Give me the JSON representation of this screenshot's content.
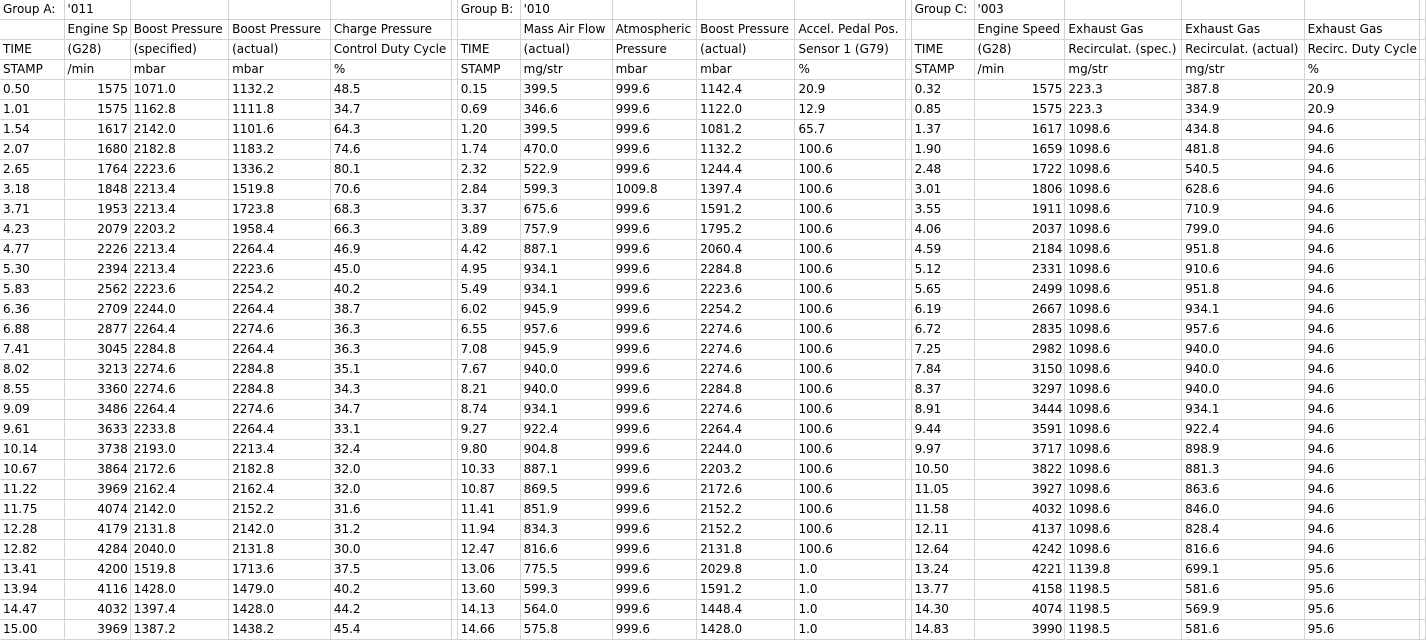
{
  "header_rows": [
    [
      "Group A:",
      "'011",
      "",
      "",
      "",
      "",
      "Group B:",
      "'010",
      "",
      "",
      "",
      "",
      "Group C:",
      "'003",
      "",
      "",
      "",
      ""
    ],
    [
      "",
      "Engine Sp",
      "Boost Pressure",
      "Boost Pressure",
      "Charge Pressure",
      "",
      "",
      "Mass Air Flow",
      "Atmospheric",
      "Boost Pressure",
      "Accel. Pedal Pos.",
      "",
      "",
      "Engine Speed",
      "Exhaust Gas",
      "Exhaust Gas",
      "Exhaust Gas",
      ""
    ],
    [
      "TIME",
      "(G28)",
      "(specified)",
      "(actual)",
      "Control Duty Cycle",
      "",
      "TIME",
      "(actual)",
      "Pressure",
      "(actual)",
      "Sensor 1 (G79)",
      "",
      "TIME",
      "(G28)",
      "Recirculat. (spec.)",
      "Recirculat. (actual)",
      "Recirc. Duty Cycle",
      ""
    ],
    [
      "STAMP",
      "/min",
      "mbar",
      "mbar",
      "%",
      "",
      "STAMP",
      "mg/str",
      "mbar",
      "mbar",
      "%",
      "",
      "STAMP",
      "/min",
      "mg/str",
      "mg/str",
      "%",
      ""
    ]
  ],
  "data_rows": [
    [
      "0.50",
      "1575",
      "1071.0",
      "1132.2",
      "48.5",
      "",
      "0.15",
      "399.5",
      "999.6",
      "1142.4",
      "20.9",
      "",
      "0.32",
      "1575",
      "223.3",
      "387.8",
      "20.9",
      ""
    ],
    [
      "1.01",
      "1575",
      "1162.8",
      "1111.8",
      "34.7",
      "",
      "0.69",
      "346.6",
      "999.6",
      "1122.0",
      "12.9",
      "",
      "0.85",
      "1575",
      "223.3",
      "334.9",
      "20.9",
      ""
    ],
    [
      "1.54",
      "1617",
      "2142.0",
      "1101.6",
      "64.3",
      "",
      "1.20",
      "399.5",
      "999.6",
      "1081.2",
      "65.7",
      "",
      "1.37",
      "1617",
      "1098.6",
      "434.8",
      "94.6",
      ""
    ],
    [
      "2.07",
      "1680",
      "2182.8",
      "1183.2",
      "74.6",
      "",
      "1.74",
      "470.0",
      "999.6",
      "1132.2",
      "100.6",
      "",
      "1.90",
      "1659",
      "1098.6",
      "481.8",
      "94.6",
      ""
    ],
    [
      "2.65",
      "1764",
      "2223.6",
      "1336.2",
      "80.1",
      "",
      "2.32",
      "522.9",
      "999.6",
      "1244.4",
      "100.6",
      "",
      "2.48",
      "1722",
      "1098.6",
      "540.5",
      "94.6",
      ""
    ],
    [
      "3.18",
      "1848",
      "2213.4",
      "1519.8",
      "70.6",
      "",
      "2.84",
      "599.3",
      "1009.8",
      "1397.4",
      "100.6",
      "",
      "3.01",
      "1806",
      "1098.6",
      "628.6",
      "94.6",
      ""
    ],
    [
      "3.71",
      "1953",
      "2213.4",
      "1723.8",
      "68.3",
      "",
      "3.37",
      "675.6",
      "999.6",
      "1591.2",
      "100.6",
      "",
      "3.55",
      "1911",
      "1098.6",
      "710.9",
      "94.6",
      ""
    ],
    [
      "4.23",
      "2079",
      "2203.2",
      "1958.4",
      "66.3",
      "",
      "3.89",
      "757.9",
      "999.6",
      "1795.2",
      "100.6",
      "",
      "4.06",
      "2037",
      "1098.6",
      "799.0",
      "94.6",
      ""
    ],
    [
      "4.77",
      "2226",
      "2213.4",
      "2264.4",
      "46.9",
      "",
      "4.42",
      "887.1",
      "999.6",
      "2060.4",
      "100.6",
      "",
      "4.59",
      "2184",
      "1098.6",
      "951.8",
      "94.6",
      ""
    ],
    [
      "5.30",
      "2394",
      "2213.4",
      "2223.6",
      "45.0",
      "",
      "4.95",
      "934.1",
      "999.6",
      "2284.8",
      "100.6",
      "",
      "5.12",
      "2331",
      "1098.6",
      "910.6",
      "94.6",
      ""
    ],
    [
      "5.83",
      "2562",
      "2223.6",
      "2254.2",
      "40.2",
      "",
      "5.49",
      "934.1",
      "999.6",
      "2223.6",
      "100.6",
      "",
      "5.65",
      "2499",
      "1098.6",
      "951.8",
      "94.6",
      ""
    ],
    [
      "6.36",
      "2709",
      "2244.0",
      "2264.4",
      "38.7",
      "",
      "6.02",
      "945.9",
      "999.6",
      "2254.2",
      "100.6",
      "",
      "6.19",
      "2667",
      "1098.6",
      "934.1",
      "94.6",
      ""
    ],
    [
      "6.88",
      "2877",
      "2264.4",
      "2274.6",
      "36.3",
      "",
      "6.55",
      "957.6",
      "999.6",
      "2274.6",
      "100.6",
      "",
      "6.72",
      "2835",
      "1098.6",
      "957.6",
      "94.6",
      ""
    ],
    [
      "7.41",
      "3045",
      "2284.8",
      "2264.4",
      "36.3",
      "",
      "7.08",
      "945.9",
      "999.6",
      "2274.6",
      "100.6",
      "",
      "7.25",
      "2982",
      "1098.6",
      "940.0",
      "94.6",
      ""
    ],
    [
      "8.02",
      "3213",
      "2274.6",
      "2284.8",
      "35.1",
      "",
      "7.67",
      "940.0",
      "999.6",
      "2274.6",
      "100.6",
      "",
      "7.84",
      "3150",
      "1098.6",
      "940.0",
      "94.6",
      ""
    ],
    [
      "8.55",
      "3360",
      "2274.6",
      "2284.8",
      "34.3",
      "",
      "8.21",
      "940.0",
      "999.6",
      "2284.8",
      "100.6",
      "",
      "8.37",
      "3297",
      "1098.6",
      "940.0",
      "94.6",
      ""
    ],
    [
      "9.09",
      "3486",
      "2264.4",
      "2274.6",
      "34.7",
      "",
      "8.74",
      "934.1",
      "999.6",
      "2274.6",
      "100.6",
      "",
      "8.91",
      "3444",
      "1098.6",
      "934.1",
      "94.6",
      ""
    ],
    [
      "9.61",
      "3633",
      "2233.8",
      "2264.4",
      "33.1",
      "",
      "9.27",
      "922.4",
      "999.6",
      "2264.4",
      "100.6",
      "",
      "9.44",
      "3591",
      "1098.6",
      "922.4",
      "94.6",
      ""
    ],
    [
      "10.14",
      "3738",
      "2193.0",
      "2213.4",
      "32.4",
      "",
      "9.80",
      "904.8",
      "999.6",
      "2244.0",
      "100.6",
      "",
      "9.97",
      "3717",
      "1098.6",
      "898.9",
      "94.6",
      ""
    ],
    [
      "10.67",
      "3864",
      "2172.6",
      "2182.8",
      "32.0",
      "",
      "10.33",
      "887.1",
      "999.6",
      "2203.2",
      "100.6",
      "",
      "10.50",
      "3822",
      "1098.6",
      "881.3",
      "94.6",
      ""
    ],
    [
      "11.22",
      "3969",
      "2162.4",
      "2162.4",
      "32.0",
      "",
      "10.87",
      "869.5",
      "999.6",
      "2172.6",
      "100.6",
      "",
      "11.05",
      "3927",
      "1098.6",
      "863.6",
      "94.6",
      ""
    ],
    [
      "11.75",
      "4074",
      "2142.0",
      "2152.2",
      "31.6",
      "",
      "11.41",
      "851.9",
      "999.6",
      "2152.2",
      "100.6",
      "",
      "11.58",
      "4032",
      "1098.6",
      "846.0",
      "94.6",
      ""
    ],
    [
      "12.28",
      "4179",
      "2131.8",
      "2142.0",
      "31.2",
      "",
      "11.94",
      "834.3",
      "999.6",
      "2152.2",
      "100.6",
      "",
      "12.11",
      "4137",
      "1098.6",
      "828.4",
      "94.6",
      ""
    ],
    [
      "12.82",
      "4284",
      "2040.0",
      "2131.8",
      "30.0",
      "",
      "12.47",
      "816.6",
      "999.6",
      "2131.8",
      "100.6",
      "",
      "12.64",
      "4242",
      "1098.6",
      "816.6",
      "94.6",
      ""
    ],
    [
      "13.41",
      "4200",
      "1519.8",
      "1713.6",
      "37.5",
      "",
      "13.06",
      "775.5",
      "999.6",
      "2029.8",
      "1.0",
      "",
      "13.24",
      "4221",
      "1139.8",
      "699.1",
      "95.6",
      ""
    ],
    [
      "13.94",
      "4116",
      "1428.0",
      "1479.0",
      "40.2",
      "",
      "13.60",
      "599.3",
      "999.6",
      "1591.2",
      "1.0",
      "",
      "13.77",
      "4158",
      "1198.5",
      "581.6",
      "95.6",
      ""
    ],
    [
      "14.47",
      "4032",
      "1397.4",
      "1428.0",
      "44.2",
      "",
      "14.13",
      "564.0",
      "999.6",
      "1448.4",
      "1.0",
      "",
      "14.30",
      "4074",
      "1198.5",
      "569.9",
      "95.6",
      ""
    ],
    [
      "15.00",
      "3969",
      "1387.2",
      "1438.2",
      "45.4",
      "",
      "14.66",
      "575.8",
      "999.6",
      "1428.0",
      "1.0",
      "",
      "14.83",
      "3990",
      "1198.5",
      "581.6",
      "95.6",
      ""
    ]
  ]
}
